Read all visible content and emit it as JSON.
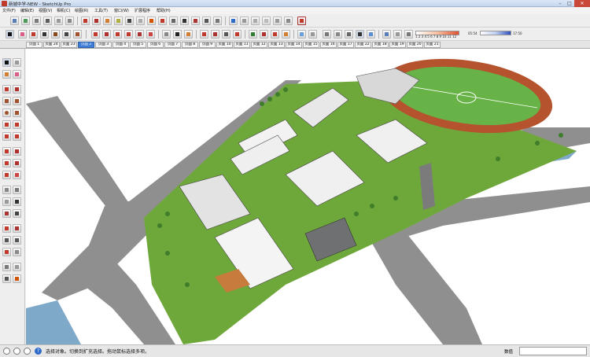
{
  "window": {
    "title": "新城中学-NEW - SketchUp Pro"
  },
  "menus": [
    "文件(F)",
    "编辑(E)",
    "视图(V)",
    "相机(C)",
    "绘图(R)",
    "工具(T)",
    "窗口(W)",
    "扩展程序",
    "帮助(H)"
  ],
  "scene_tabs": [
    "页面 1",
    "页面 24",
    "页面 23",
    "页面 2",
    "页面 3",
    "页面 4",
    "页面 5",
    "页面 6",
    "页面 7",
    "页面 8",
    "页面 9",
    "页面 10",
    "页面 11",
    "页面 12",
    "页面 13",
    "页面 14",
    "页面 15",
    "页面 16",
    "页面 17",
    "页面 22",
    "页面 18",
    "页面 19",
    "页面 20",
    "页面 21"
  ],
  "active_scene": "页面 2",
  "shadow": {
    "scale": "1 2 3 4 5 6 7 8 9 10 11 12",
    "time_left": "05:54",
    "time_right": "17:50"
  },
  "status": {
    "hint": "选择对象。切换到扩充选择。拖动鼠标选择多项。",
    "measure_label": "数值",
    "measure_value": ""
  },
  "colors": {
    "accent": "#3e7ed6",
    "grass": "#6fa83a",
    "road": "#9a9a9a",
    "water": "#7fa9c9",
    "track": "#b5532e"
  }
}
